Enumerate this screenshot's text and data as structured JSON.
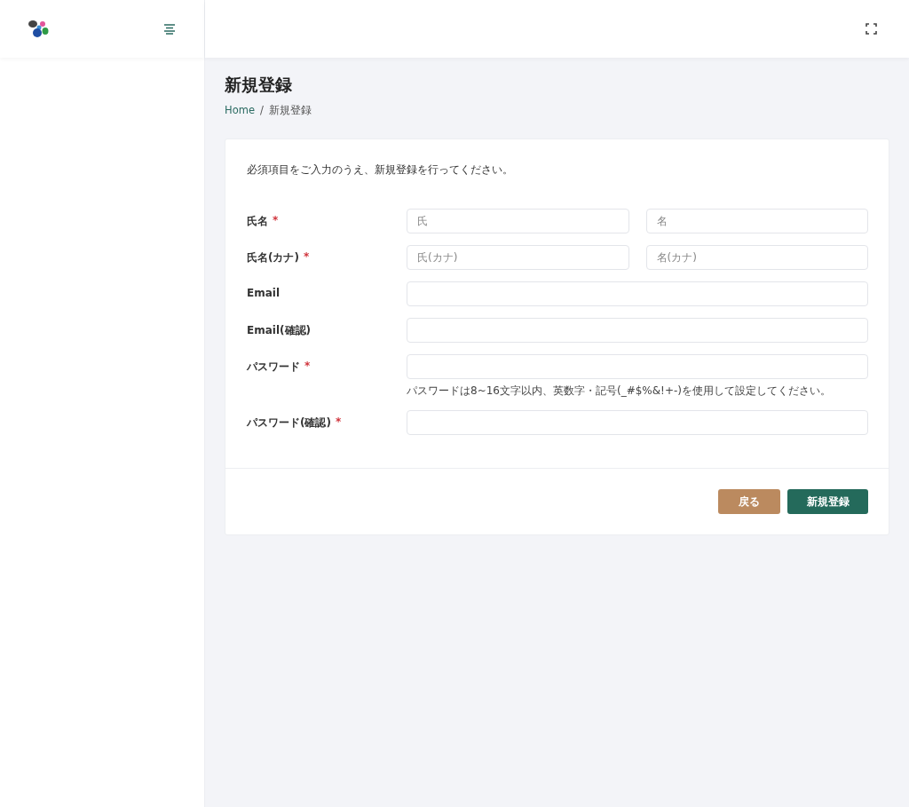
{
  "page": {
    "title": "新規登録"
  },
  "breadcrumb": [
    {
      "label": "Home",
      "kind": "link"
    },
    {
      "label": "新規登録",
      "kind": "current"
    }
  ],
  "breadcrumb_separator": "/",
  "form": {
    "intro": "必須項目をご入力のうえ、新規登録を行ってください。",
    "fields": [
      {
        "label": "氏名",
        "required_mark": "*",
        "kind": "split",
        "inputs": [
          {
            "placeholder": "氏"
          },
          {
            "placeholder": "名"
          }
        ]
      },
      {
        "label": "氏名(カナ)",
        "required_mark": "*",
        "kind": "split",
        "inputs": [
          {
            "placeholder": "氏(カナ)"
          },
          {
            "placeholder": "名(カナ)"
          }
        ]
      },
      {
        "label": "Email",
        "kind": "single"
      },
      {
        "label": "Email(確認)",
        "kind": "single"
      },
      {
        "label": "パスワード",
        "required_mark": "*",
        "kind": "single",
        "hint": "パスワードは8~16文字以内、英数字・記号(_#$%&!+-)を使用して設定してください。"
      },
      {
        "label": "パスワード(確認)",
        "required_mark": "*",
        "kind": "single"
      }
    ],
    "buttons": [
      {
        "label": "戻る",
        "kind": "back"
      },
      {
        "label": "新規登録",
        "kind": "primary"
      }
    ]
  }
}
